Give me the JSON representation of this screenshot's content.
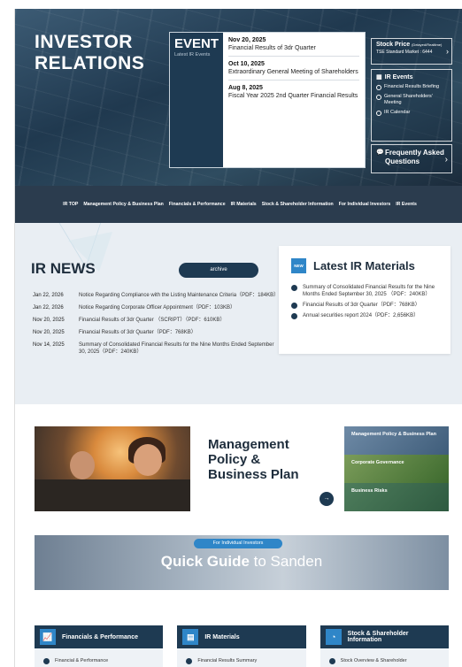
{
  "hero": {
    "title_line1": "INVESTOR",
    "title_line2": "RELATIONS"
  },
  "event": {
    "title": "EVENT",
    "subtitle": "Latest IR Events",
    "items": [
      {
        "date": "Nov 20, 2025",
        "text": "Financial Results of 3dr Quarter"
      },
      {
        "date": "Oct 10, 2025",
        "text": "Extraordinary General Meeting of Shareholders"
      },
      {
        "date": "Aug 8, 2025",
        "text": "Fiscal Year 2025 2nd Quarter Financial Results"
      }
    ]
  },
  "stock_price": {
    "title": "Stock Price",
    "note": "(Delayed/Realtime)",
    "market": "TSE Standard Market : 6444"
  },
  "ir_events": {
    "title": "IR Events",
    "items": [
      "Financial Results Briefing",
      "General Shareholders' Meeting",
      "IR Calendar"
    ]
  },
  "faq": {
    "label": "Frequently Asked Questions"
  },
  "nav": {
    "items": [
      "IR TOP",
      "Management Policy & Business Plan",
      "Financials & Performance",
      "IR Materials",
      "Stock & Shareholder Information",
      "For Individual Investors",
      "IR Events"
    ]
  },
  "news": {
    "title": "IR NEWS",
    "archive_label": "archive",
    "items": [
      {
        "date": "Jan 22, 2026",
        "text": "Notice Regarding Compliance with the Listing Maintenance Criteria（PDF：184KB）"
      },
      {
        "date": "Jan 22, 2026",
        "text": "Notice Regarding Corporate Officer Appointment（PDF：103KB）"
      },
      {
        "date": "Nov 20, 2025",
        "text": "Financial Results of 3dr Quarter （SCRIPT）（PDF：610KB）"
      },
      {
        "date": "Nov 20, 2025",
        "text": "Financial Results of 3dr Quarter（PDF：768KB）"
      },
      {
        "date": "Nov 14, 2025",
        "text": "Summary of Consolidated Financial Results for the Nine Months Ended September 30, 2025（PDF：240KB）"
      }
    ]
  },
  "latest": {
    "badge": "NEW",
    "title": "Latest IR Materials",
    "items": [
      "Summary of Consolidated Financial Results for the Nine Months Ended September 30, 2025 （PDF：240KB）",
      "Financial Results of 3dr Quarter（PDF：768KB）",
      "Annual securities report 2024（PDF：2,656KB）"
    ]
  },
  "management": {
    "line1": "Management",
    "line2": "Policy &",
    "line3": "Business Plan",
    "links": [
      "Management Policy & Business Plan",
      "Corporate Governance",
      "Business Risks"
    ]
  },
  "quick_guide": {
    "tag": "For Individual Investors",
    "bold": "Quick Guide",
    "rest": " to Sanden"
  },
  "cards": [
    {
      "title": "Financials & Performance",
      "item": "Financial & Performance"
    },
    {
      "title": "IR Materials",
      "item": "Financial Results Summary"
    },
    {
      "title": "Stock & Shareholder Information",
      "item": "Stock Overview & Shareholder"
    }
  ]
}
